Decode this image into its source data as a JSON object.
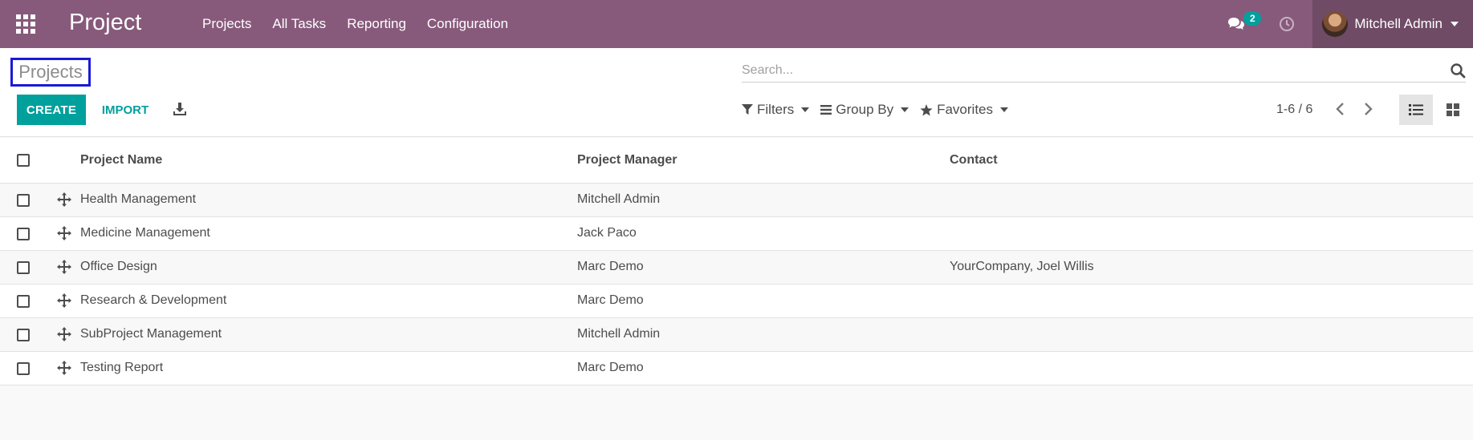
{
  "navbar": {
    "app_name": "Project",
    "menu": [
      "Projects",
      "All Tasks",
      "Reporting",
      "Configuration"
    ],
    "chat_badge": "2",
    "user_name": "Mitchell Admin",
    "color": "#875a7b"
  },
  "control": {
    "breadcrumb": "Projects",
    "search_placeholder": "Search...",
    "create_label": "CREATE",
    "import_label": "IMPORT",
    "filters_label": "Filters",
    "groupby_label": "Group By",
    "favorites_label": "Favorites",
    "pager": "1-6 / 6",
    "accent": "#00a09d"
  },
  "table": {
    "headers": {
      "name": "Project Name",
      "manager": "Project Manager",
      "contact": "Contact"
    },
    "rows": [
      {
        "name": "Health Management",
        "manager": "Mitchell Admin",
        "contact": ""
      },
      {
        "name": "Medicine Management",
        "manager": "Jack Paco",
        "contact": ""
      },
      {
        "name": "Office Design",
        "manager": "Marc Demo",
        "contact": "YourCompany, Joel Willis"
      },
      {
        "name": "Research & Development",
        "manager": "Marc Demo",
        "contact": ""
      },
      {
        "name": "SubProject Management",
        "manager": "Mitchell Admin",
        "contact": ""
      },
      {
        "name": "Testing Report",
        "manager": "Marc Demo",
        "contact": ""
      }
    ]
  }
}
